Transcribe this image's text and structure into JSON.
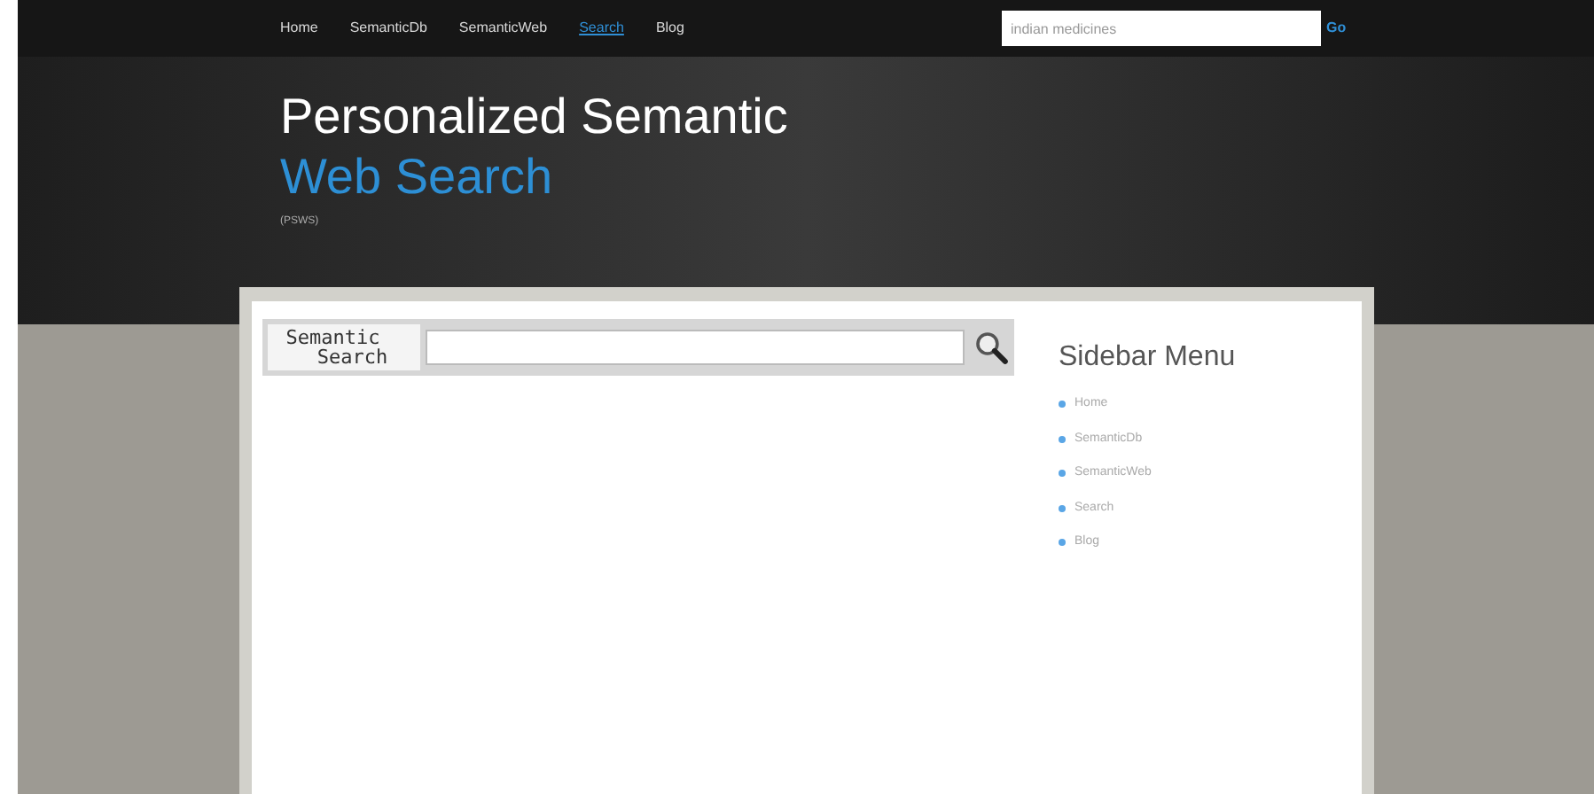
{
  "nav": {
    "items": [
      {
        "label": "Home",
        "selected": false
      },
      {
        "label": "SemanticDb",
        "selected": false
      },
      {
        "label": "SemanticWeb",
        "selected": false
      },
      {
        "label": "Search",
        "selected": true
      },
      {
        "label": "Blog",
        "selected": false
      }
    ],
    "search": {
      "value": "indian medicines"
    },
    "go": "Go"
  },
  "header": {
    "title": "Personalized Semantic",
    "subtitle": "Web Search",
    "tagline": "(PSWS)"
  },
  "semantic_search": {
    "logo_top": "Semantic",
    "logo_bottom": "Search"
  },
  "sidebar": {
    "title": "Sidebar Menu",
    "items": [
      "Home",
      "SemanticDb",
      "SemanticWeb",
      "Search",
      "Blog"
    ]
  }
}
